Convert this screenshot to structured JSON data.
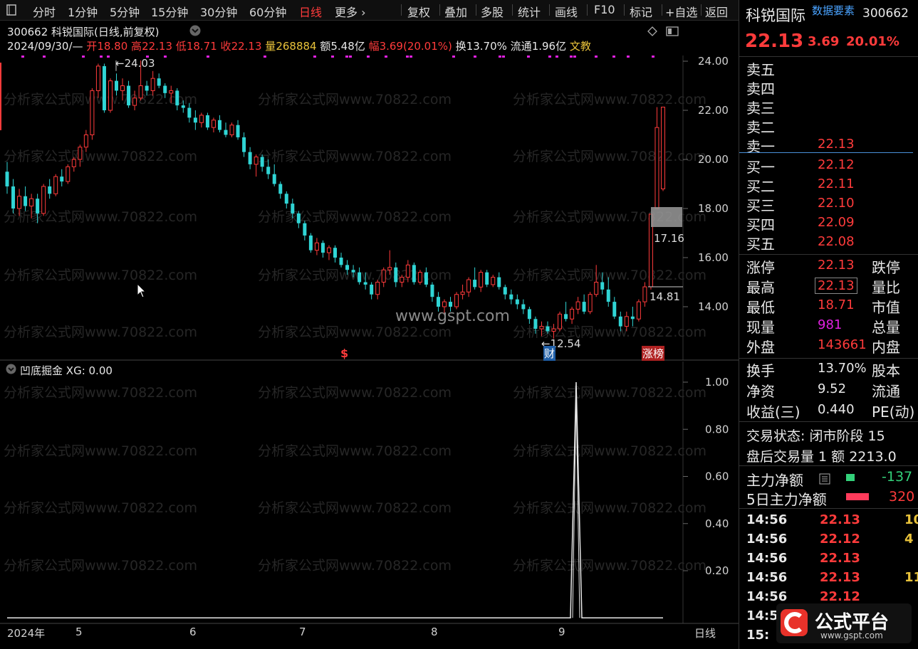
{
  "toolbar": {
    "left_items": [
      "分时",
      "1分钟",
      "5分钟",
      "15分钟",
      "30分钟",
      "60分钟",
      "日线",
      "更多"
    ],
    "active": "日线",
    "right_items": [
      "复权",
      "叠加",
      "多股",
      "统计",
      "画线",
      "F10",
      "标记",
      "+自选",
      "返回"
    ]
  },
  "header": {
    "title": "300662 科锐国际(日线,前复权)",
    "date": "2024/09/30/—",
    "open_label": "开",
    "open": "18.80",
    "high_label": "高",
    "high": "22.13",
    "low_label": "低",
    "low": "18.71",
    "close_label": "收",
    "close": "22.13",
    "vol_label": "量",
    "vol": "268884",
    "amt_label": "额",
    "amt": "5.48亿",
    "chg_label": "幅",
    "chg": "3.69(20.01%)",
    "turn_label": "换",
    "turn": "13.70%",
    "float_label": "流通",
    "float": "1.96亿",
    "wen": "文",
    "extra": "教"
  },
  "annotations": {
    "high_marker": "24.03",
    "low_marker": "12.54",
    "price_17": "17.16",
    "price_14": "14.81",
    "cai": "财",
    "zhangbang": "涨榜",
    "dollar": "$",
    "watermark_site": "www.gspt.com",
    "watermark_text": "分析家公式网www.70822.com"
  },
  "price_axis": [
    "24.00",
    "22.00",
    "20.00",
    "18.00",
    "16.00",
    "14.00"
  ],
  "indicator": {
    "title": "凹底掘金",
    "xg_label": "XG: 0.00",
    "axis": [
      "1.00",
      "0.80",
      "0.60",
      "0.40",
      "0.20"
    ]
  },
  "time_axis": {
    "labels": [
      "2024年",
      "5",
      "6",
      "7",
      "8",
      "9"
    ],
    "period": "日线"
  },
  "chart_data": {
    "type": "candlestick",
    "title": "300662 科锐国际(日线,前复权)",
    "ylim": [
      12.0,
      24.5
    ],
    "note": "daily OHLC approximated from screenshot",
    "candles": [
      [
        19.5,
        19.9,
        18.6,
        18.9
      ],
      [
        18.9,
        19.2,
        17.8,
        18.0
      ],
      [
        18.0,
        18.8,
        17.7,
        18.5
      ],
      [
        18.5,
        18.9,
        17.9,
        18.1
      ],
      [
        18.1,
        18.6,
        17.6,
        18.4
      ],
      [
        18.4,
        18.6,
        17.4,
        17.8
      ],
      [
        17.8,
        19.0,
        17.7,
        18.9
      ],
      [
        18.9,
        19.2,
        18.4,
        18.6
      ],
      [
        18.6,
        19.4,
        18.5,
        19.3
      ],
      [
        19.3,
        19.6,
        18.9,
        19.1
      ],
      [
        19.1,
        19.8,
        19.0,
        19.7
      ],
      [
        19.7,
        20.1,
        19.5,
        20.0
      ],
      [
        20.0,
        20.6,
        19.7,
        20.5
      ],
      [
        20.5,
        21.2,
        20.3,
        21.0
      ],
      [
        21.0,
        22.9,
        20.8,
        22.8
      ],
      [
        22.8,
        23.9,
        22.5,
        23.8
      ],
      [
        23.8,
        23.9,
        21.9,
        22.0
      ],
      [
        22.0,
        23.3,
        21.9,
        23.2
      ],
      [
        23.2,
        23.5,
        22.6,
        22.8
      ],
      [
        22.8,
        23.3,
        22.4,
        23.0
      ],
      [
        23.0,
        23.2,
        22.1,
        22.2
      ],
      [
        22.2,
        22.8,
        22.0,
        22.5
      ],
      [
        22.5,
        24.03,
        22.4,
        23.0
      ],
      [
        23.0,
        23.2,
        22.6,
        22.8
      ],
      [
        22.8,
        23.6,
        22.6,
        23.3
      ],
      [
        23.3,
        23.5,
        22.9,
        23.0
      ],
      [
        23.0,
        23.1,
        22.5,
        22.7
      ],
      [
        22.7,
        23.0,
        22.3,
        22.8
      ],
      [
        22.8,
        22.9,
        22.0,
        22.2
      ],
      [
        22.2,
        22.4,
        21.9,
        22.1
      ],
      [
        22.1,
        22.3,
        21.5,
        21.7
      ],
      [
        21.7,
        22.0,
        21.2,
        21.5
      ],
      [
        21.5,
        21.9,
        21.3,
        21.8
      ],
      [
        21.8,
        21.9,
        21.2,
        21.3
      ],
      [
        21.3,
        21.7,
        21.1,
        21.6
      ],
      [
        21.6,
        21.8,
        21.1,
        21.2
      ],
      [
        21.2,
        21.5,
        20.9,
        21.0
      ],
      [
        21.0,
        21.5,
        20.9,
        21.4
      ],
      [
        21.4,
        21.6,
        20.8,
        20.9
      ],
      [
        20.9,
        21.1,
        20.1,
        20.3
      ],
      [
        20.3,
        20.5,
        19.6,
        19.8
      ],
      [
        19.8,
        20.2,
        19.3,
        20.1
      ],
      [
        20.1,
        20.2,
        19.5,
        19.7
      ],
      [
        19.7,
        20.0,
        19.2,
        19.4
      ],
      [
        19.4,
        19.8,
        18.9,
        19.0
      ],
      [
        19.0,
        19.1,
        18.4,
        18.6
      ],
      [
        18.6,
        18.7,
        18.0,
        18.2
      ],
      [
        18.2,
        18.4,
        17.6,
        17.8
      ],
      [
        17.8,
        17.9,
        17.2,
        17.4
      ],
      [
        17.4,
        17.5,
        16.7,
        16.9
      ],
      [
        16.9,
        17.0,
        16.2,
        16.3
      ],
      [
        16.3,
        16.8,
        16.1,
        16.6
      ],
      [
        16.6,
        16.7,
        16.0,
        16.2
      ],
      [
        16.2,
        16.5,
        15.9,
        16.4
      ],
      [
        16.4,
        16.5,
        15.8,
        16.0
      ],
      [
        16.0,
        16.2,
        15.6,
        15.7
      ],
      [
        15.7,
        15.9,
        15.3,
        15.5
      ],
      [
        15.5,
        15.7,
        15.2,
        15.4
      ],
      [
        15.4,
        15.6,
        14.9,
        15.0
      ],
      [
        15.0,
        15.4,
        14.7,
        14.9
      ],
      [
        14.9,
        15.0,
        14.3,
        14.5
      ],
      [
        14.5,
        15.1,
        14.3,
        15.0
      ],
      [
        15.0,
        15.6,
        14.8,
        15.5
      ],
      [
        15.5,
        16.3,
        15.3,
        15.6
      ],
      [
        15.6,
        15.8,
        14.8,
        15.0
      ],
      [
        15.0,
        15.3,
        14.8,
        15.2
      ],
      [
        15.2,
        15.9,
        15.0,
        15.7
      ],
      [
        15.7,
        15.8,
        14.9,
        15.0
      ],
      [
        15.0,
        15.5,
        14.9,
        15.4
      ],
      [
        15.4,
        15.6,
        14.8,
        14.9
      ],
      [
        14.9,
        15.0,
        14.2,
        14.4
      ],
      [
        14.4,
        14.6,
        13.8,
        14.0
      ],
      [
        14.0,
        14.3,
        13.7,
        14.2
      ],
      [
        14.2,
        14.4,
        13.8,
        14.0
      ],
      [
        14.0,
        14.6,
        13.9,
        14.5
      ],
      [
        14.5,
        14.9,
        14.3,
        14.6
      ],
      [
        14.6,
        15.2,
        14.4,
        15.1
      ],
      [
        15.1,
        15.6,
        14.7,
        14.8
      ],
      [
        14.8,
        15.5,
        14.6,
        15.4
      ],
      [
        15.4,
        15.5,
        14.8,
        14.9
      ],
      [
        14.9,
        15.3,
        14.8,
        15.2
      ],
      [
        15.2,
        15.4,
        14.7,
        14.8
      ],
      [
        14.8,
        14.9,
        14.3,
        14.5
      ],
      [
        14.5,
        14.7,
        14.1,
        14.3
      ],
      [
        14.3,
        14.5,
        13.9,
        14.1
      ],
      [
        14.1,
        14.3,
        13.7,
        13.9
      ],
      [
        13.9,
        14.0,
        13.3,
        13.5
      ],
      [
        13.5,
        13.6,
        12.9,
        13.1
      ],
      [
        13.1,
        13.4,
        12.8,
        13.2
      ],
      [
        13.2,
        13.4,
        12.9,
        13.0
      ],
      [
        13.0,
        13.3,
        12.7,
        13.1
      ],
      [
        13.1,
        13.8,
        13.0,
        13.7
      ],
      [
        13.7,
        14.2,
        13.4,
        13.5
      ],
      [
        13.5,
        14.0,
        13.3,
        13.9
      ],
      [
        13.9,
        14.4,
        13.7,
        14.2
      ],
      [
        14.2,
        14.5,
        13.7,
        13.8
      ],
      [
        13.8,
        14.6,
        13.7,
        14.5
      ],
      [
        14.5,
        15.7,
        14.4,
        15.0
      ],
      [
        15.0,
        15.4,
        14.5,
        14.7
      ],
      [
        14.7,
        15.2,
        14.0,
        14.2
      ],
      [
        14.2,
        14.4,
        13.5,
        13.6
      ],
      [
        13.6,
        13.8,
        13.0,
        13.2
      ],
      [
        13.2,
        13.8,
        13.0,
        13.6
      ],
      [
        13.6,
        14.0,
        13.2,
        13.5
      ],
      [
        13.5,
        14.3,
        13.4,
        14.2
      ],
      [
        14.2,
        15.0,
        14.0,
        14.81
      ],
      [
        14.81,
        17.77,
        14.7,
        17.77
      ],
      [
        18.0,
        22.13,
        18.5,
        21.3
      ],
      [
        18.8,
        22.13,
        18.71,
        22.13
      ]
    ]
  },
  "right_panel": {
    "name": "科锐国际",
    "data_label": "数据要素",
    "code": "300662",
    "price": "22.13",
    "change": "3.69",
    "change_pct": "20.01%",
    "asks": [
      {
        "label": "卖五",
        "price": ""
      },
      {
        "label": "卖四",
        "price": ""
      },
      {
        "label": "卖三",
        "price": ""
      },
      {
        "label": "卖二",
        "price": ""
      },
      {
        "label": "卖一",
        "price": "22.13"
      }
    ],
    "bids": [
      {
        "label": "买一",
        "price": "22.12"
      },
      {
        "label": "买二",
        "price": "22.11"
      },
      {
        "label": "买三",
        "price": "22.10"
      },
      {
        "label": "买四",
        "price": "22.09"
      },
      {
        "label": "买五",
        "price": "22.08"
      }
    ],
    "stats1": [
      {
        "l": "涨停",
        "v": "22.13",
        "r": "跌停"
      },
      {
        "l": "最高",
        "v": "22.13",
        "r": "量比"
      },
      {
        "l": "最低",
        "v": "18.71",
        "r": "市值"
      },
      {
        "l": "现量",
        "v": "981",
        "r": "总量"
      },
      {
        "l": "外盘",
        "v": "143661",
        "r": "内盘"
      }
    ],
    "stats2": [
      {
        "l": "换手",
        "v": "13.70%",
        "r": "股本"
      },
      {
        "l": "净资",
        "v": "9.52",
        "r": "流通"
      },
      {
        "l": "收益(三)",
        "v": "0.440",
        "r": "PE(动)"
      }
    ],
    "trade_state": "交易状态: 闭市阶段 15",
    "after_hours": "盘后交易量 1 额 2213.0",
    "main_net": {
      "label": "主力净额",
      "value": "-137"
    },
    "main_net5": {
      "label": "5日主力净额",
      "value": "320"
    },
    "ticks": [
      {
        "t": "14:56",
        "p": "22.13",
        "v": "10"
      },
      {
        "t": "14:56",
        "p": "22.12",
        "v": "4"
      },
      {
        "t": "14:56",
        "p": "22.13",
        "v": ""
      },
      {
        "t": "14:56",
        "p": "22.13",
        "v": "11"
      },
      {
        "t": "14:56",
        "p": "22.12",
        "v": ""
      },
      {
        "t": "14:5",
        "p": "",
        "v": ""
      },
      {
        "t": "15:",
        "p": "",
        "v": ""
      }
    ],
    "logo_text": "公式平台",
    "logo_url": "www.gspt.com"
  },
  "colors": {
    "up": "#ff3b3b",
    "down": "#30d5d5",
    "bg": "#000000",
    "grid": "#2a2a2a"
  }
}
